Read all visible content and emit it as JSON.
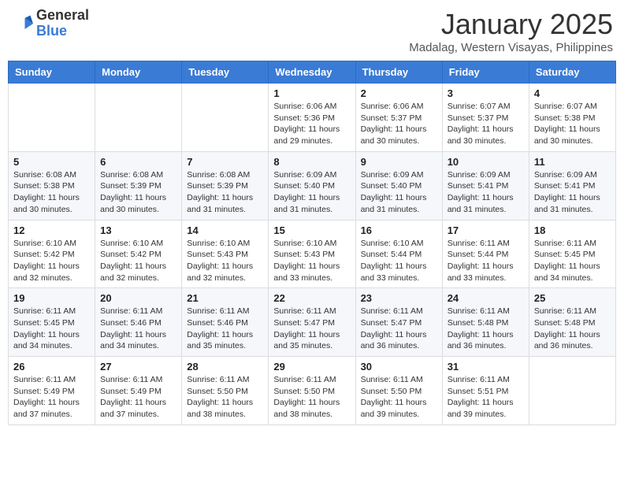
{
  "header": {
    "logo_general": "General",
    "logo_blue": "Blue",
    "month_title": "January 2025",
    "location": "Madalag, Western Visayas, Philippines"
  },
  "weekdays": [
    "Sunday",
    "Monday",
    "Tuesday",
    "Wednesday",
    "Thursday",
    "Friday",
    "Saturday"
  ],
  "weeks": [
    [
      {
        "day": "",
        "sunrise": "",
        "sunset": "",
        "daylight": ""
      },
      {
        "day": "",
        "sunrise": "",
        "sunset": "",
        "daylight": ""
      },
      {
        "day": "",
        "sunrise": "",
        "sunset": "",
        "daylight": ""
      },
      {
        "day": "1",
        "sunrise": "Sunrise: 6:06 AM",
        "sunset": "Sunset: 5:36 PM",
        "daylight": "Daylight: 11 hours and 29 minutes."
      },
      {
        "day": "2",
        "sunrise": "Sunrise: 6:06 AM",
        "sunset": "Sunset: 5:37 PM",
        "daylight": "Daylight: 11 hours and 30 minutes."
      },
      {
        "day": "3",
        "sunrise": "Sunrise: 6:07 AM",
        "sunset": "Sunset: 5:37 PM",
        "daylight": "Daylight: 11 hours and 30 minutes."
      },
      {
        "day": "4",
        "sunrise": "Sunrise: 6:07 AM",
        "sunset": "Sunset: 5:38 PM",
        "daylight": "Daylight: 11 hours and 30 minutes."
      }
    ],
    [
      {
        "day": "5",
        "sunrise": "Sunrise: 6:08 AM",
        "sunset": "Sunset: 5:38 PM",
        "daylight": "Daylight: 11 hours and 30 minutes."
      },
      {
        "day": "6",
        "sunrise": "Sunrise: 6:08 AM",
        "sunset": "Sunset: 5:39 PM",
        "daylight": "Daylight: 11 hours and 30 minutes."
      },
      {
        "day": "7",
        "sunrise": "Sunrise: 6:08 AM",
        "sunset": "Sunset: 5:39 PM",
        "daylight": "Daylight: 11 hours and 31 minutes."
      },
      {
        "day": "8",
        "sunrise": "Sunrise: 6:09 AM",
        "sunset": "Sunset: 5:40 PM",
        "daylight": "Daylight: 11 hours and 31 minutes."
      },
      {
        "day": "9",
        "sunrise": "Sunrise: 6:09 AM",
        "sunset": "Sunset: 5:40 PM",
        "daylight": "Daylight: 11 hours and 31 minutes."
      },
      {
        "day": "10",
        "sunrise": "Sunrise: 6:09 AM",
        "sunset": "Sunset: 5:41 PM",
        "daylight": "Daylight: 11 hours and 31 minutes."
      },
      {
        "day": "11",
        "sunrise": "Sunrise: 6:09 AM",
        "sunset": "Sunset: 5:41 PM",
        "daylight": "Daylight: 11 hours and 31 minutes."
      }
    ],
    [
      {
        "day": "12",
        "sunrise": "Sunrise: 6:10 AM",
        "sunset": "Sunset: 5:42 PM",
        "daylight": "Daylight: 11 hours and 32 minutes."
      },
      {
        "day": "13",
        "sunrise": "Sunrise: 6:10 AM",
        "sunset": "Sunset: 5:42 PM",
        "daylight": "Daylight: 11 hours and 32 minutes."
      },
      {
        "day": "14",
        "sunrise": "Sunrise: 6:10 AM",
        "sunset": "Sunset: 5:43 PM",
        "daylight": "Daylight: 11 hours and 32 minutes."
      },
      {
        "day": "15",
        "sunrise": "Sunrise: 6:10 AM",
        "sunset": "Sunset: 5:43 PM",
        "daylight": "Daylight: 11 hours and 33 minutes."
      },
      {
        "day": "16",
        "sunrise": "Sunrise: 6:10 AM",
        "sunset": "Sunset: 5:44 PM",
        "daylight": "Daylight: 11 hours and 33 minutes."
      },
      {
        "day": "17",
        "sunrise": "Sunrise: 6:11 AM",
        "sunset": "Sunset: 5:44 PM",
        "daylight": "Daylight: 11 hours and 33 minutes."
      },
      {
        "day": "18",
        "sunrise": "Sunrise: 6:11 AM",
        "sunset": "Sunset: 5:45 PM",
        "daylight": "Daylight: 11 hours and 34 minutes."
      }
    ],
    [
      {
        "day": "19",
        "sunrise": "Sunrise: 6:11 AM",
        "sunset": "Sunset: 5:45 PM",
        "daylight": "Daylight: 11 hours and 34 minutes."
      },
      {
        "day": "20",
        "sunrise": "Sunrise: 6:11 AM",
        "sunset": "Sunset: 5:46 PM",
        "daylight": "Daylight: 11 hours and 34 minutes."
      },
      {
        "day": "21",
        "sunrise": "Sunrise: 6:11 AM",
        "sunset": "Sunset: 5:46 PM",
        "daylight": "Daylight: 11 hours and 35 minutes."
      },
      {
        "day": "22",
        "sunrise": "Sunrise: 6:11 AM",
        "sunset": "Sunset: 5:47 PM",
        "daylight": "Daylight: 11 hours and 35 minutes."
      },
      {
        "day": "23",
        "sunrise": "Sunrise: 6:11 AM",
        "sunset": "Sunset: 5:47 PM",
        "daylight": "Daylight: 11 hours and 36 minutes."
      },
      {
        "day": "24",
        "sunrise": "Sunrise: 6:11 AM",
        "sunset": "Sunset: 5:48 PM",
        "daylight": "Daylight: 11 hours and 36 minutes."
      },
      {
        "day": "25",
        "sunrise": "Sunrise: 6:11 AM",
        "sunset": "Sunset: 5:48 PM",
        "daylight": "Daylight: 11 hours and 36 minutes."
      }
    ],
    [
      {
        "day": "26",
        "sunrise": "Sunrise: 6:11 AM",
        "sunset": "Sunset: 5:49 PM",
        "daylight": "Daylight: 11 hours and 37 minutes."
      },
      {
        "day": "27",
        "sunrise": "Sunrise: 6:11 AM",
        "sunset": "Sunset: 5:49 PM",
        "daylight": "Daylight: 11 hours and 37 minutes."
      },
      {
        "day": "28",
        "sunrise": "Sunrise: 6:11 AM",
        "sunset": "Sunset: 5:50 PM",
        "daylight": "Daylight: 11 hours and 38 minutes."
      },
      {
        "day": "29",
        "sunrise": "Sunrise: 6:11 AM",
        "sunset": "Sunset: 5:50 PM",
        "daylight": "Daylight: 11 hours and 38 minutes."
      },
      {
        "day": "30",
        "sunrise": "Sunrise: 6:11 AM",
        "sunset": "Sunset: 5:50 PM",
        "daylight": "Daylight: 11 hours and 39 minutes."
      },
      {
        "day": "31",
        "sunrise": "Sunrise: 6:11 AM",
        "sunset": "Sunset: 5:51 PM",
        "daylight": "Daylight: 11 hours and 39 minutes."
      },
      {
        "day": "",
        "sunrise": "",
        "sunset": "",
        "daylight": ""
      }
    ]
  ]
}
